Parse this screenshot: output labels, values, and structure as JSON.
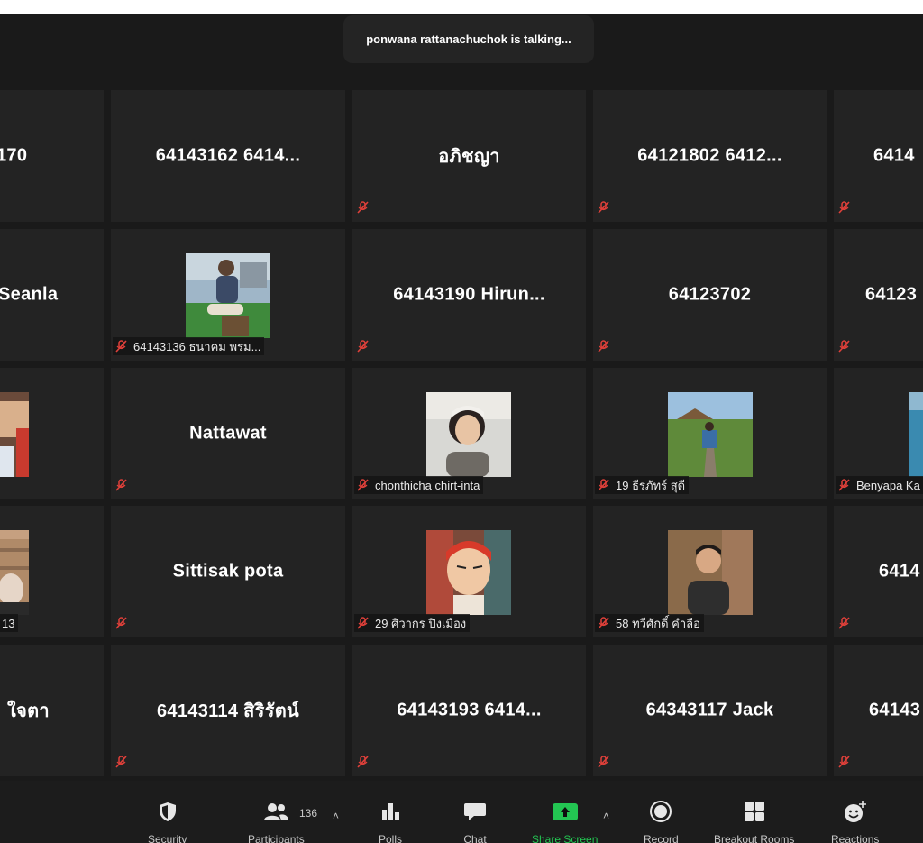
{
  "banner": {
    "talking_text": "ponwana rattanachuchok is talking..."
  },
  "tiles": {
    "r1c0": "170",
    "r1c1": "64143162 6414...",
    "r1c2": "อภิชญา",
    "r1c3": "64121802 6412...",
    "r1c4": "6414",
    "r2c0": "Seanla",
    "r2c1_name": "64143136 ธนาคม พรม...",
    "r2c2": "64143190 Hirun...",
    "r2c3": "64123702",
    "r2c4": "64123",
    "r3c1": "Nattawat",
    "r3c2_name": "chonthicha chirt-inta",
    "r3c3_name": "19 ธีรภัทร์ สุดี",
    "r3c4_name": "Benyapa Ka",
    "r4c0_name": "13",
    "r4c1": "Sittisak pota",
    "r4c2_name": "29 ศิวากร ปิงเมือง",
    "r4c3_name": "58 ทวีศักดิ์ คำลือ",
    "r4c4": "6414",
    "r5c0": "ใจตา",
    "r5c1": "64143114 สิริรัตน์",
    "r5c2": "64143193 6414...",
    "r5c3": "64343117 Jack",
    "r5c4": "64143"
  },
  "toolbar": {
    "security": "Security",
    "participants": "Participants",
    "participants_count": "136",
    "polls": "Polls",
    "chat": "Chat",
    "share_screen": "Share Screen",
    "record": "Record",
    "breakout_rooms": "Breakout Rooms",
    "reactions": "Reactions"
  },
  "colors": {
    "background": "#1a1a1a",
    "tile": "#232323",
    "muted_icon": "#e0403a",
    "share_green": "#23c552"
  }
}
